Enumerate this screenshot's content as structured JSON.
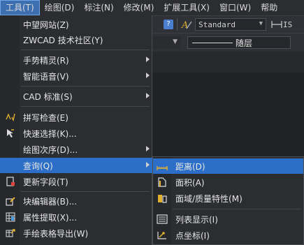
{
  "menubar": {
    "items": [
      {
        "label": "工具(T)"
      },
      {
        "label": "绘图(D)"
      },
      {
        "label": "标注(N)"
      },
      {
        "label": "修改(M)"
      },
      {
        "label": "扩展工具(X)"
      },
      {
        "label": "窗口(W)"
      },
      {
        "label": "帮助"
      }
    ]
  },
  "toolbar": {
    "help_glyph": "?",
    "text_style": "Standard",
    "dim_style_partial": "IS",
    "linetype_label": "随层"
  },
  "tools_menu": {
    "items": [
      {
        "label": "中望网站(Z)"
      },
      {
        "label": "ZWCAD 技术社区(Y)"
      },
      {
        "label": "手势精灵(R)"
      },
      {
        "label": "智能语音(V)"
      },
      {
        "label": "CAD 标准(S)"
      },
      {
        "label": "拼写检查(E)"
      },
      {
        "label": "快速选择(K)..."
      },
      {
        "label": "绘图次序(D)..."
      },
      {
        "label": "查询(Q)"
      },
      {
        "label": "更新字段(T)"
      },
      {
        "label": "块编辑器(B)..."
      },
      {
        "label": "属性提取(X)..."
      },
      {
        "label": "手绘表格导出(W)"
      }
    ]
  },
  "inquiry_submenu": {
    "items": [
      {
        "label": "距离(D)"
      },
      {
        "label": "面积(A)"
      },
      {
        "label": "面域/质量特性(M)"
      },
      {
        "label": "列表显示(I)"
      },
      {
        "label": "点坐标(I)"
      }
    ]
  },
  "colors": {
    "highlight": "#2d6fc8",
    "menu_bg": "#2b2d31"
  }
}
